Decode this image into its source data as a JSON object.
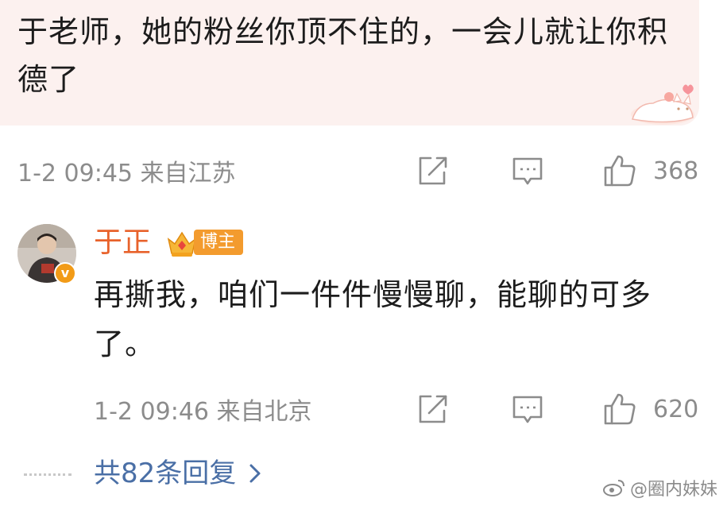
{
  "top_comment": {
    "text": "于老师，她的粉丝你顶不住的，一会儿就让你积德了",
    "time_location": "1-2 09:45 来自江苏",
    "like_count": "368"
  },
  "reply": {
    "username": "于正",
    "badge_label": "博主",
    "text": "再撕我，咱们一件件慢慢聊，能聊的可多了。",
    "time_location": "1-2 09:46 来自北京",
    "like_count": "620"
  },
  "replies_link": {
    "label": "共82条回复",
    "chevron": "›"
  },
  "watermark": {
    "text": "@圈内妹妹"
  },
  "icons": {
    "share": "share-icon",
    "comment": "comment-icon",
    "like": "thumbs-up-icon",
    "verified": "verified-v-icon",
    "crown": "crown-icon"
  },
  "colors": {
    "bubble_bg": "#fcf1ef",
    "username": "#e8622b",
    "link": "#4a6fa6",
    "meta": "#8c8c8c",
    "badge": "#f39b2e"
  }
}
